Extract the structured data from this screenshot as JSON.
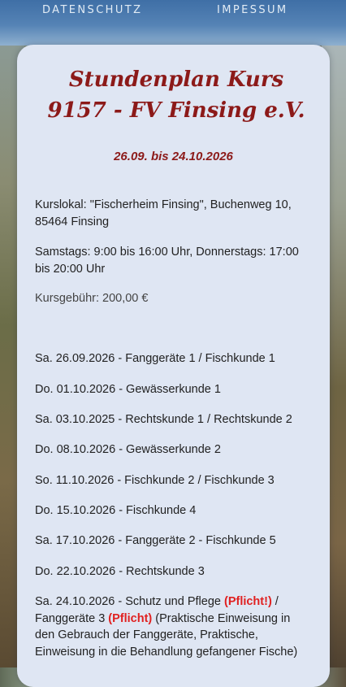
{
  "nav": {
    "datenschutz": "DATENSCHUTZ",
    "impressum": "IMPESSUM"
  },
  "card": {
    "title": "Stundenplan Kurs  9157 - FV Finsing e.V.",
    "dates": "26.09. bis 24.10.2026",
    "location": "Kurslokal: \"Fischerheim Finsing\", Buchenweg 10, 85464 Finsing",
    "times": "Samstags: 9:00 bis 16:00 Uhr,  Donnerstags: 17:00 bis 20:00 Uhr",
    "fee": "Kursgebühr: 200,00 €"
  },
  "schedule": [
    "Sa. 26.09.2026 - Fanggeräte 1 / Fischkunde 1",
    "Do. 01.10.2026 - Gewässerkunde 1",
    "Sa. 03.10.2025 -  Rechtskunde 1 / Rechtskunde 2",
    "Do. 08.10.2026 - Gewässerkunde 2",
    "So. 11.10.2026 - Fischkunde 2 / Fischkunde 3",
    "Do. 15.10.2026 - Fischkunde 4",
    "Sa. 17.10.2026 - Fanggeräte 2 - Fischkunde 5",
    "Do. 22.10.2026 - Rechtskunde 3"
  ],
  "last_entry": {
    "part1": "Sa. 24.10.2026 - Schutz und Pflege ",
    "req1": "(Pflicht!)",
    "part2": " / Fanggeräte 3  ",
    "req2": "(Pflicht)",
    "part3": " (Praktische Einweisung in den Gebrauch der Fanggeräte, Praktische, Einweisung in die Behandlung gefangener Fische)"
  },
  "colors": {
    "title_red": "#8c1a19",
    "required_red": "#e02020",
    "card_bg": "#dfe6f3",
    "nav_blue": "#4a79ad"
  }
}
